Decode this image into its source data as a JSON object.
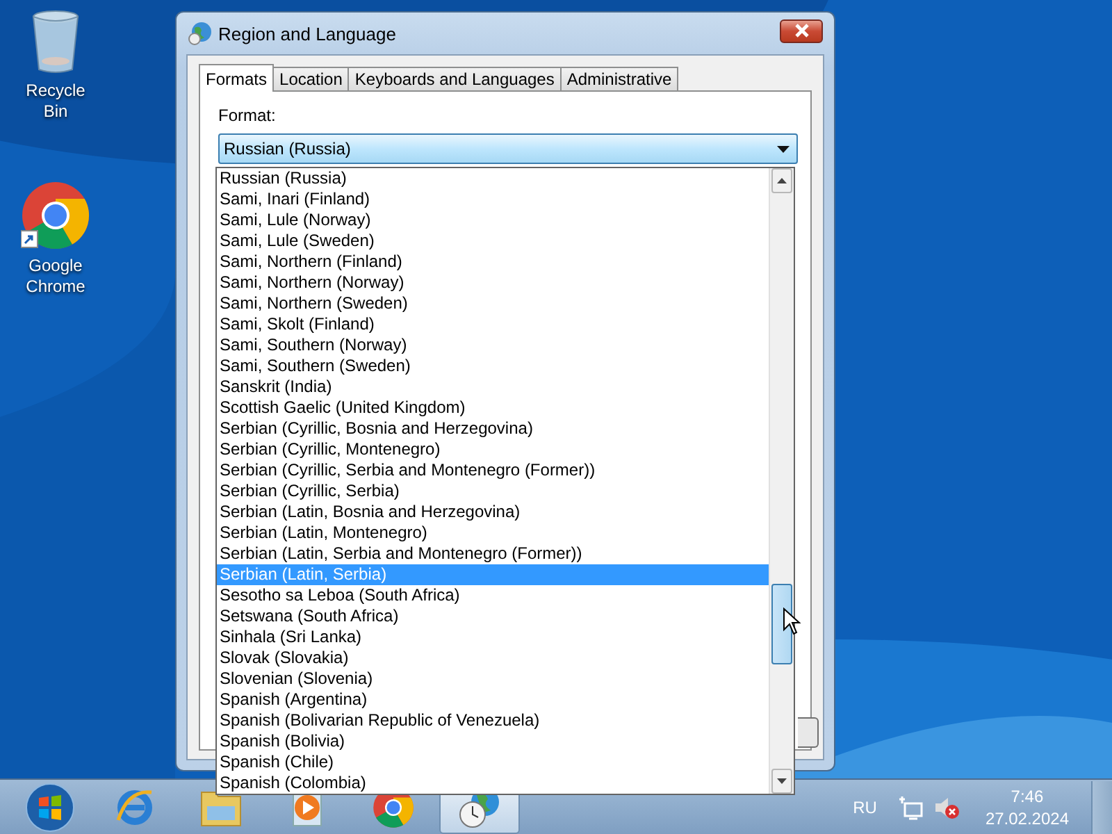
{
  "desktop_icons": [
    {
      "kind": "bin",
      "label": "Recycle Bin"
    },
    {
      "kind": "chrome",
      "label": "Google Chrome"
    }
  ],
  "window": {
    "title": "Region and Language"
  },
  "tabs": [
    {
      "label": "Formats",
      "selected": true
    },
    {
      "label": "Location",
      "selected": false
    },
    {
      "label": "Keyboards and Languages",
      "selected": false
    },
    {
      "label": "Administrative",
      "selected": false
    }
  ],
  "format": {
    "label": "Format:",
    "value": "Russian (Russia)"
  },
  "format_list": [
    {
      "label": "Russian (Russia)",
      "selected": false
    },
    {
      "label": "Sami, Inari (Finland)",
      "selected": false
    },
    {
      "label": "Sami, Lule (Norway)",
      "selected": false
    },
    {
      "label": "Sami, Lule (Sweden)",
      "selected": false
    },
    {
      "label": "Sami, Northern (Finland)",
      "selected": false
    },
    {
      "label": "Sami, Northern (Norway)",
      "selected": false
    },
    {
      "label": "Sami, Northern (Sweden)",
      "selected": false
    },
    {
      "label": "Sami, Skolt (Finland)",
      "selected": false
    },
    {
      "label": "Sami, Southern (Norway)",
      "selected": false
    },
    {
      "label": "Sami, Southern (Sweden)",
      "selected": false
    },
    {
      "label": "Sanskrit (India)",
      "selected": false
    },
    {
      "label": "Scottish Gaelic (United Kingdom)",
      "selected": false
    },
    {
      "label": "Serbian (Cyrillic, Bosnia and Herzegovina)",
      "selected": false
    },
    {
      "label": "Serbian (Cyrillic, Montenegro)",
      "selected": false
    },
    {
      "label": "Serbian (Cyrillic, Serbia and Montenegro (Former))",
      "selected": false
    },
    {
      "label": "Serbian (Cyrillic, Serbia)",
      "selected": false
    },
    {
      "label": "Serbian (Latin, Bosnia and Herzegovina)",
      "selected": false
    },
    {
      "label": "Serbian (Latin, Montenegro)",
      "selected": false
    },
    {
      "label": "Serbian (Latin, Serbia and Montenegro (Former))",
      "selected": false
    },
    {
      "label": "Serbian (Latin, Serbia)",
      "selected": true
    },
    {
      "label": "Sesotho sa Leboa (South Africa)",
      "selected": false
    },
    {
      "label": "Setswana (South Africa)",
      "selected": false
    },
    {
      "label": "Sinhala (Sri Lanka)",
      "selected": false
    },
    {
      "label": "Slovak (Slovakia)",
      "selected": false
    },
    {
      "label": "Slovenian (Slovenia)",
      "selected": false
    },
    {
      "label": "Spanish (Argentina)",
      "selected": false
    },
    {
      "label": "Spanish (Bolivarian Republic of Venezuela)",
      "selected": false
    },
    {
      "label": "Spanish (Bolivia)",
      "selected": false
    },
    {
      "label": "Spanish (Chile)",
      "selected": false
    },
    {
      "label": "Spanish (Colombia)",
      "selected": false
    }
  ],
  "taskbar_apps": [
    {
      "kind": "globe-e",
      "active": false
    },
    {
      "kind": "folder",
      "active": false
    },
    {
      "kind": "player",
      "active": false
    },
    {
      "kind": "chrome",
      "active": false
    },
    {
      "kind": "clock-globe",
      "active": true
    }
  ],
  "tray": {
    "language": "RU",
    "time": "7:46",
    "date": "27.02.2024"
  }
}
